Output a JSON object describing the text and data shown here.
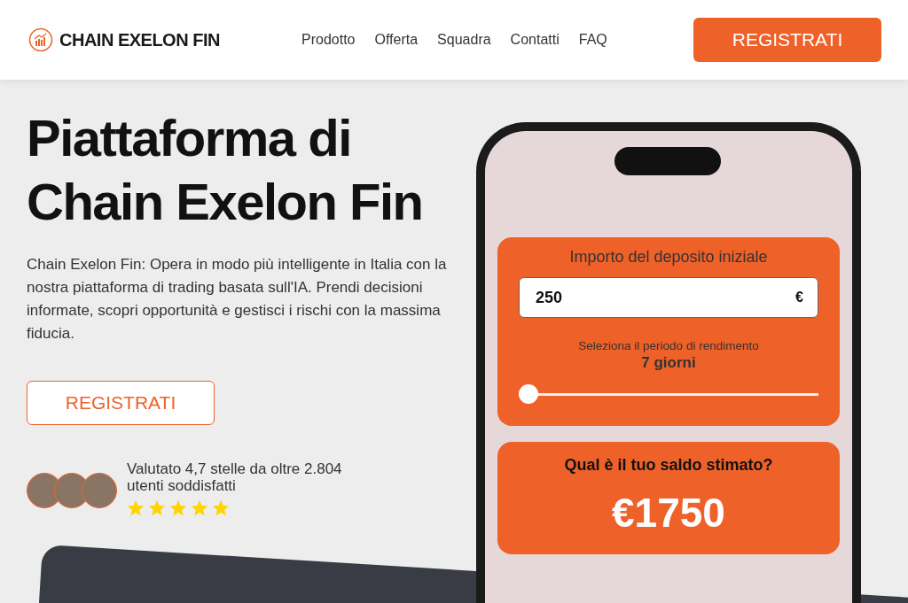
{
  "header": {
    "brand": "CHAIN EXELON FIN",
    "nav": [
      "Prodotto",
      "Offerta",
      "Squadra",
      "Contatti",
      "FAQ"
    ],
    "cta": "REGISTRATI"
  },
  "hero": {
    "title_lines": [
      "Piattaforma di",
      "Chain Exelon Fin"
    ],
    "description": "Chain Exelon Fin: Opera in modo più intelligente in Italia con la nostra piattaforma di trading basata sull'IA. Prendi decisioni informate, scopri opportunità e gestisci i rischi con la massima fiducia.",
    "button": "REGISTRATI",
    "rating": {
      "text": "Valutato 4,7 stelle da oltre 2.804 utenti soddisfatti",
      "stars": 5
    }
  },
  "calculator": {
    "deposit_label": "Importo del deposito iniziale",
    "deposit_value": "250",
    "currency": "€",
    "period_label": "Seleziona il periodo di rendimento",
    "period_value": "7 giorni",
    "level": 0.0,
    "result_label": "Qual è il tuo saldo stimato?",
    "result_value": "€1750"
  }
}
